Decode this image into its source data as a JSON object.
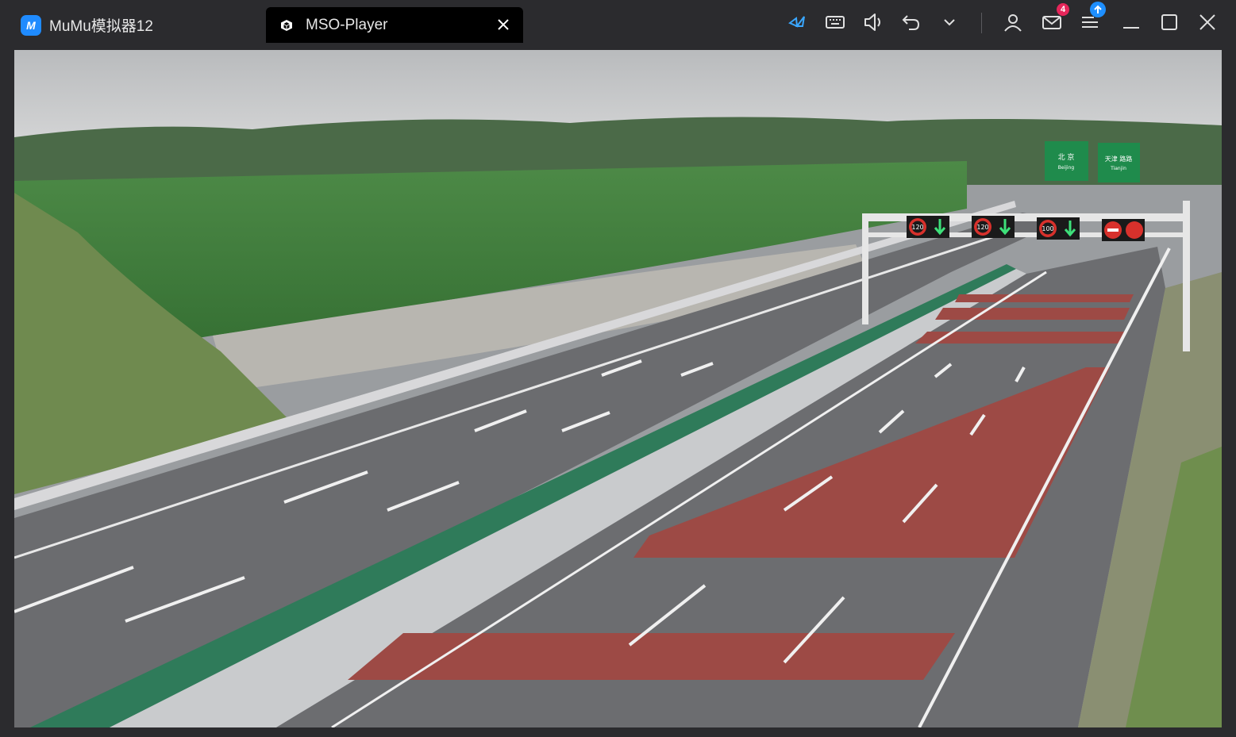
{
  "window": {
    "app_tab_label": "MuMu模拟器12",
    "app_logo_letter": "M",
    "active_tab_label": "MSO-Player",
    "mail_badge_count": "4"
  },
  "toolbar": {
    "icons": [
      "butterfly-icon",
      "keyboard-icon",
      "volume-icon",
      "back-icon",
      "chevron-down-icon",
      "user-icon",
      "mail-icon",
      "menu-icon",
      "minimize-icon",
      "maximize-icon",
      "close-icon"
    ]
  },
  "scene": {
    "signs": {
      "left_sign_city": "北 京",
      "left_sign_sub": "Beijing",
      "right_sign_city": "天津 路路",
      "right_sign_sub": "Tianjin"
    },
    "gantry": [
      {
        "speed": "120",
        "type": "arrow"
      },
      {
        "speed": "120",
        "type": "arrow"
      },
      {
        "speed": "100",
        "type": "arrow"
      },
      {
        "speed": "",
        "type": "no-entry"
      }
    ],
    "colors": {
      "sky": "#c8cacb",
      "field": "#3f7a3a",
      "road": "#6e6f72",
      "red_lane": "#9d4a45",
      "barrier": "#2f7b5a"
    }
  }
}
